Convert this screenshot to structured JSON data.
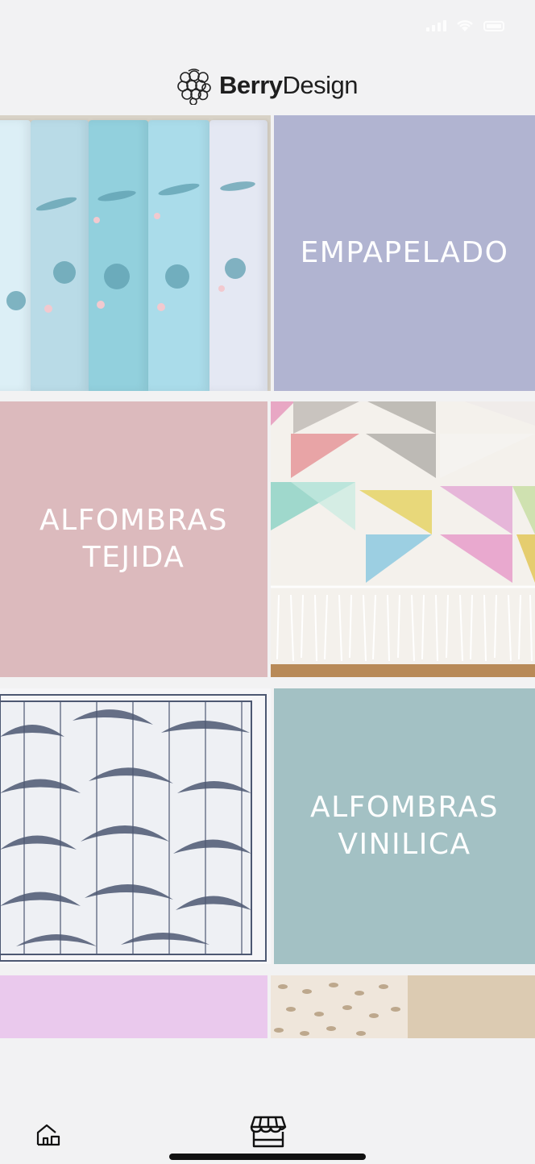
{
  "brand": {
    "name_part1": "Berry",
    "name_part2": "Design"
  },
  "categories": [
    {
      "label": "EMPAPELADO",
      "color": "#b1b4d1"
    },
    {
      "label": "ALFOMBRAS\nTEJIDA",
      "color": "#dcbabd"
    },
    {
      "label": "ALFOMBRAS\nVINILICA",
      "color": "#a3c1c4"
    },
    {
      "label": "",
      "color": "#eac9ed"
    }
  ],
  "colors": {
    "background": "#f2f2f3",
    "roll_light": "#cfe6f1",
    "roll_mid": "#9fd5e0",
    "palm": "#4d5872"
  },
  "nav": {
    "items": [
      {
        "icon": "home-icon"
      },
      {
        "icon": "store-icon"
      }
    ]
  }
}
